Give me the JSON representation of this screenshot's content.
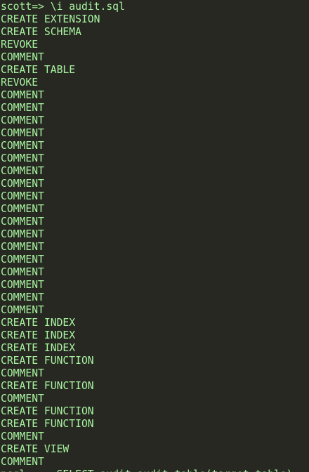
{
  "terminal": {
    "prompt": "scott=> ",
    "command": "\\i audit.sql",
    "output": [
      "CREATE EXTENSION",
      "CREATE SCHEMA",
      "REVOKE",
      "COMMENT",
      "CREATE TABLE",
      "REVOKE",
      "COMMENT",
      "COMMENT",
      "COMMENT",
      "COMMENT",
      "COMMENT",
      "COMMENT",
      "COMMENT",
      "COMMENT",
      "COMMENT",
      "COMMENT",
      "COMMENT",
      "COMMENT",
      "COMMENT",
      "COMMENT",
      "COMMENT",
      "COMMENT",
      "COMMENT",
      "COMMENT",
      "CREATE INDEX",
      "CREATE INDEX",
      "CREATE INDEX",
      "CREATE FUNCTION",
      "COMMENT",
      "CREATE FUNCTION",
      "COMMENT",
      "CREATE FUNCTION",
      "CREATE FUNCTION",
      "COMMENT",
      "CREATE VIEW",
      "COMMENT",
      "psql:... SELECT audit.audit_table(target_table)"
    ],
    "colors": {
      "background": "#272822",
      "text": "#a8f3a0"
    }
  }
}
